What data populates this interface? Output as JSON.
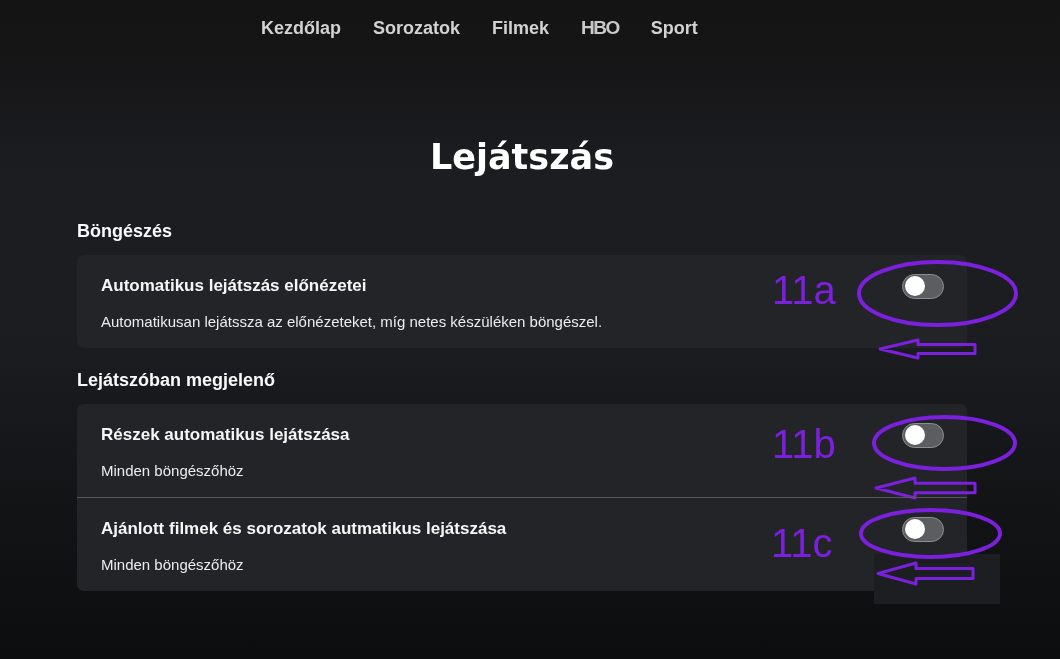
{
  "nav": {
    "items": [
      {
        "label": "Kezdőlap",
        "kind": "text"
      },
      {
        "label": "Sorozatok",
        "kind": "text"
      },
      {
        "label": "Filmek",
        "kind": "text"
      },
      {
        "label": "HBO",
        "kind": "logo"
      },
      {
        "label": "Sport",
        "kind": "text"
      }
    ]
  },
  "page": {
    "title": "Lejátszás"
  },
  "sections": [
    {
      "heading": "Böngészés",
      "settings": [
        {
          "title": "Automatikus lejátszás előnézetei",
          "description": "Automatikusan lejátssza az előnézeteket, míg netes készüléken böngészel.",
          "on": false,
          "annotation": "11a"
        }
      ]
    },
    {
      "heading": "Lejátszóban megjelenő",
      "settings": [
        {
          "title": "Részek automatikus lejátszása",
          "description": "Minden böngészőhöz",
          "on": false,
          "annotation": "11b"
        },
        {
          "title": "Ajánlott filmek és sorozatok autmatikus lejátszása",
          "description": "Minden böngészőhöz",
          "on": false,
          "annotation": "11c"
        }
      ]
    }
  ]
}
